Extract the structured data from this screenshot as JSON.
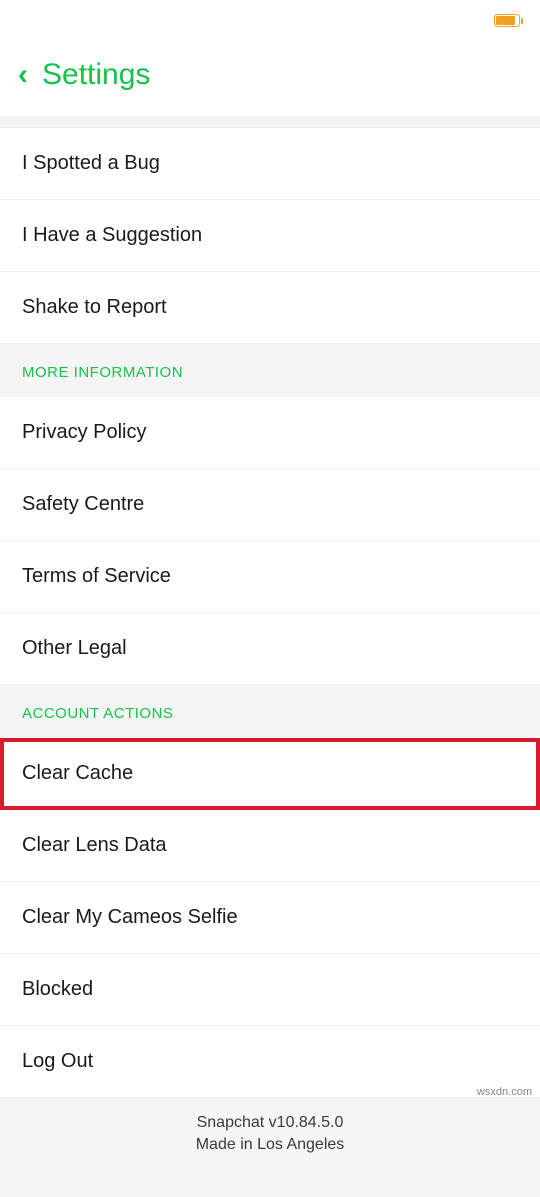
{
  "header": {
    "title": "Settings"
  },
  "feedback_items": [
    {
      "label": "I Spotted a Bug",
      "name": "item-spotted-bug"
    },
    {
      "label": "I Have a Suggestion",
      "name": "item-suggestion"
    },
    {
      "label": "Shake to Report",
      "name": "item-shake-report"
    }
  ],
  "sections": [
    {
      "title": "MORE INFORMATION",
      "name": "section-more-information",
      "items": [
        {
          "label": "Privacy Policy",
          "name": "item-privacy-policy"
        },
        {
          "label": "Safety Centre",
          "name": "item-safety-centre"
        },
        {
          "label": "Terms of Service",
          "name": "item-terms-of-service"
        },
        {
          "label": "Other Legal",
          "name": "item-other-legal"
        }
      ]
    },
    {
      "title": "ACCOUNT ACTIONS",
      "name": "section-account-actions",
      "items": [
        {
          "label": "Clear Cache",
          "name": "item-clear-cache",
          "highlighted": true
        },
        {
          "label": "Clear Lens Data",
          "name": "item-clear-lens-data"
        },
        {
          "label": "Clear My Cameos Selfie",
          "name": "item-clear-cameos-selfie"
        },
        {
          "label": "Blocked",
          "name": "item-blocked"
        },
        {
          "label": "Log Out",
          "name": "item-log-out"
        }
      ]
    }
  ],
  "footer": {
    "version_line": "Snapchat v10.84.5.0",
    "made_in_line": "Made in Los Angeles"
  },
  "watermark": "wsxdn.com",
  "colors": {
    "accent": "#17c24a",
    "highlight": "#d81b2c"
  }
}
